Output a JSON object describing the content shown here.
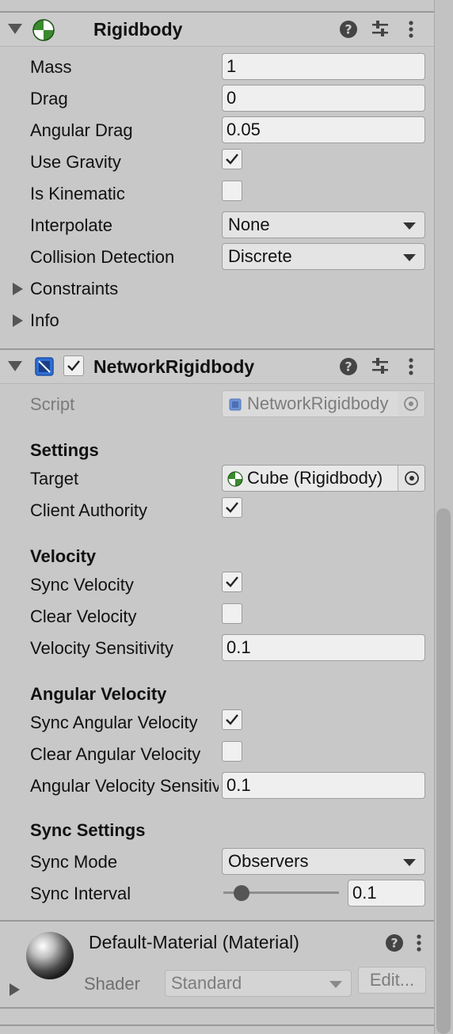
{
  "rigidbody": {
    "title": "Rigidbody",
    "fields": {
      "mass_label": "Mass",
      "mass_value": "1",
      "drag_label": "Drag",
      "drag_value": "0",
      "angular_drag_label": "Angular Drag",
      "angular_drag_value": "0.05",
      "use_gravity_label": "Use Gravity",
      "use_gravity_checked": true,
      "is_kinematic_label": "Is Kinematic",
      "is_kinematic_checked": false,
      "interpolate_label": "Interpolate",
      "interpolate_value": "None",
      "collision_label": "Collision Detection",
      "collision_value": "Discrete",
      "constraints_label": "Constraints",
      "info_label": "Info"
    }
  },
  "network_rigidbody": {
    "title": "NetworkRigidbody",
    "enabled": true,
    "script_label": "Script",
    "script_value": "NetworkRigidbody",
    "settings_heading": "Settings",
    "target_label": "Target",
    "target_value": "Cube (Rigidbody)",
    "client_authority_label": "Client Authority",
    "client_authority_checked": true,
    "velocity_heading": "Velocity",
    "sync_velocity_label": "Sync Velocity",
    "sync_velocity_checked": true,
    "clear_velocity_label": "Clear Velocity",
    "clear_velocity_checked": false,
    "velocity_sensitivity_label": "Velocity Sensitivity",
    "velocity_sensitivity_value": "0.1",
    "angular_heading": "Angular Velocity",
    "sync_angular_label": "Sync Angular Velocity",
    "sync_angular_checked": true,
    "clear_angular_label": "Clear Angular Velocity",
    "clear_angular_checked": false,
    "angular_sensitivity_label": "Angular Velocity Sensitivity",
    "angular_sensitivity_value": "0.1",
    "sync_settings_heading": "Sync Settings",
    "sync_mode_label": "Sync Mode",
    "sync_mode_value": "Observers",
    "sync_interval_label": "Sync Interval",
    "sync_interval_value": "0.1",
    "sync_interval_slider_fraction": 0.1
  },
  "material": {
    "title": "Default-Material (Material)",
    "shader_label": "Shader",
    "shader_value": "Standard",
    "edit_label": "Edit..."
  },
  "colors": {
    "panel_bg": "#c8c8c8",
    "rigidbody_icon": "#3a8a2e",
    "script_icon": "#2f6fd6"
  }
}
